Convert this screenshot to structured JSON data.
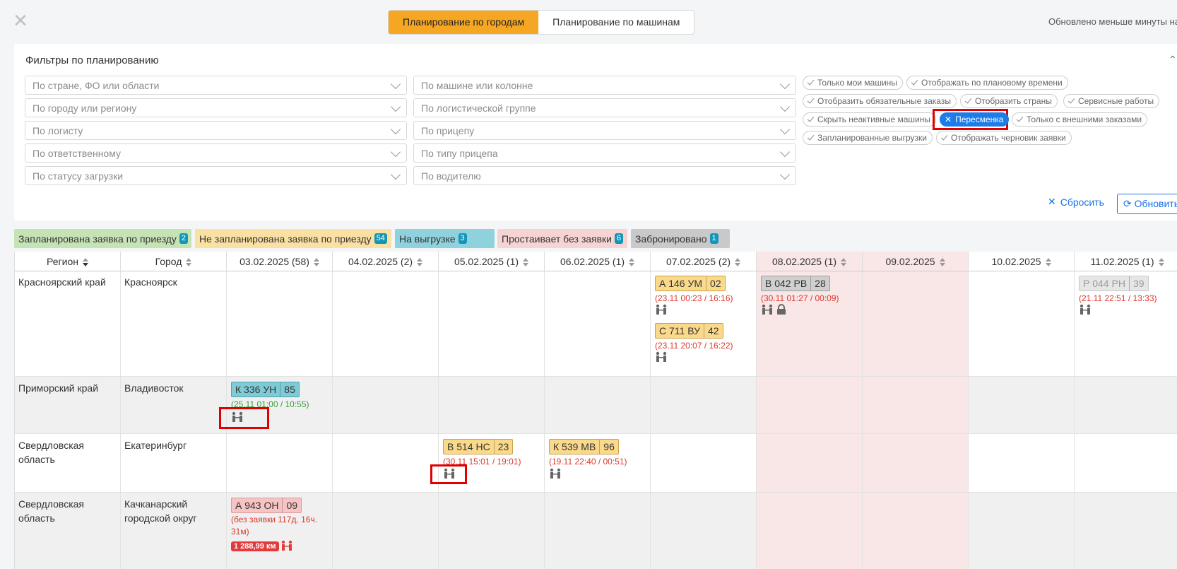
{
  "topbar": {
    "close_icon": "close-icon",
    "tabs": [
      {
        "label": "Планирование по городам",
        "active": true
      },
      {
        "label": "Планирование по машинам",
        "active": false
      }
    ],
    "updated_text": "Обновлено меньше минуты назад"
  },
  "filters": {
    "title": "Фильтры по планированию",
    "selects_left": [
      "По стране, ФО или области",
      "По городу или региону",
      "По логисту",
      "По ответственному",
      "По статусу загрузки"
    ],
    "selects_right": [
      "По машине или колонне",
      "По логистической группе",
      "По прицепу",
      "По типу прицепа",
      "По водителю"
    ],
    "tags": [
      "Только мои машины",
      "Отображать по плановому времени",
      "Отобразить обязательные заказы",
      "Отобразить страны",
      "Сервисные работы",
      "Скрыть неактивные машины",
      "Пересменка",
      "Только с внешними заказами",
      "Запланированные выгрузки",
      "Отображать черновик заявки"
    ],
    "active_tag": "Пересменка",
    "reset_label": "Сбросить",
    "refresh_label": "Обновить"
  },
  "legend": [
    {
      "label": "Запланирована заявка по приезду",
      "count": "2",
      "color": "#c6e3b5"
    },
    {
      "label": "Не запланирована заявка по приезду",
      "count": "54",
      "color": "#fbe0a3"
    },
    {
      "label": "На выгрузке",
      "count": "3",
      "color": "#8fd1dc"
    },
    {
      "label": "Простаивает без заявки",
      "count": "6",
      "color": "#f7d4d4"
    },
    {
      "label": "Забронировано",
      "count": "1",
      "color": "#c9c9c9"
    }
  ],
  "table": {
    "headers": [
      "Регион",
      "Город",
      "03.02.2025 (58)",
      "04.02.2025 (2)",
      "05.02.2025 (1)",
      "06.02.2025 (1)",
      "07.02.2025 (2)",
      "08.02.2025 (1)",
      "09.02.2025",
      "10.02.2025",
      "11.02.2025 (1)"
    ],
    "rows": [
      {
        "region": "Красноярский край",
        "city": "Красноярск"
      },
      {
        "region": "Приморский край",
        "city": "Владивосток"
      },
      {
        "region": "Свердловская область",
        "city": "Екатеринбург"
      },
      {
        "region": "Свердловская область",
        "city": "Качканарский городской округ"
      }
    ],
    "cards": {
      "a146": {
        "plate": "А 146 УМ",
        "num": "02",
        "time": "(23.11 00:23 / 16:16)"
      },
      "c711": {
        "plate": "С 711 ВУ",
        "num": "42",
        "time": "(23.11 20:07 / 16:22)"
      },
      "b042": {
        "plate": "В 042 РВ",
        "num": "28",
        "time": "(30.11 01:27 / 00:09)"
      },
      "p044": {
        "plate": "Р 044 РН",
        "num": "39",
        "time": "(21.11 22:51 / 13:33)"
      },
      "k336": {
        "plate": "К 336 УН",
        "num": "85",
        "time": "(25.11 01:00 / 10:55)"
      },
      "b514": {
        "plate": "В 514 НС",
        "num": "23",
        "time": "(30.11 15:01 / 19:01)"
      },
      "k539": {
        "plate": "К 539 МВ",
        "num": "96",
        "time": "(19.11 22:40 / 00:51)"
      },
      "a943": {
        "plate": "А 943 ОН",
        "num": "09",
        "time_line1": "(без заявки 117д. 16ч.",
        "time_line2": "31м)",
        "km": "1 288,99 км"
      }
    }
  }
}
